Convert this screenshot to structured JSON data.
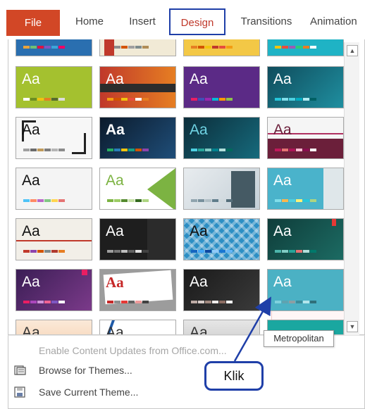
{
  "ribbon": {
    "tabs": [
      {
        "label": "File"
      },
      {
        "label": "Home"
      },
      {
        "label": "Insert"
      },
      {
        "label": "Design"
      },
      {
        "label": "Transitions"
      },
      {
        "label": "Animation"
      }
    ],
    "active_tab": "Design"
  },
  "gallery": {
    "sample_text": "Aa",
    "hovered_theme": "Metropolitan"
  },
  "menu": {
    "enable_updates": "Enable Content Updates from Office.com...",
    "browse": "Browse for Themes...",
    "save": "Save Current Theme..."
  },
  "tooltip": "Metropolitan",
  "annotation": "Klik",
  "colors": {
    "file_tab": "#d24726",
    "design_border": "#1f3fa8",
    "design_text": "#c0392b",
    "annotation": "#1f3fa8"
  }
}
